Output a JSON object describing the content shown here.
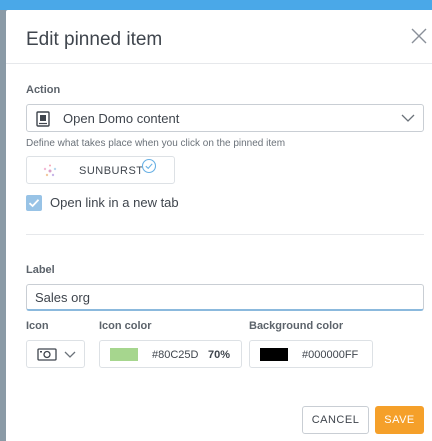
{
  "dialog": {
    "title": "Edit pinned item",
    "close_icon": "close-icon"
  },
  "action": {
    "label": "Action",
    "selected": "Open Domo content",
    "selected_icon": "card-icon",
    "help": "Define what takes place when you click on the pinned item",
    "content_chip": {
      "label": "SUNBURST",
      "icon": "sunburst-icon",
      "verified": true
    },
    "new_tab": {
      "label": "Open link in a new tab",
      "checked": true
    }
  },
  "label_field": {
    "label": "Label",
    "value": "Sales org"
  },
  "icon_field": {
    "label": "Icon",
    "selected_icon": "camera-icon"
  },
  "icon_color": {
    "label": "Icon color",
    "hex": "#80C25D",
    "opacity": "70%",
    "swatch": "#a6d68e"
  },
  "background_color": {
    "label": "Background color",
    "hex": "#000000FF",
    "swatch": "#000000"
  },
  "buttons": {
    "cancel": "CANCEL",
    "save": "SAVE"
  },
  "colors": {
    "accent": "#f5a02a",
    "checkbox": "#98c3e6",
    "topbar": "#4aa8e8"
  }
}
